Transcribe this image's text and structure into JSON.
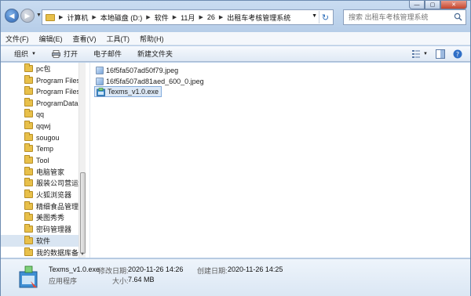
{
  "address": {
    "crumbs": [
      "计算机",
      "本地磁盘 (D:)",
      "软件",
      "11月",
      "26",
      "出租车考核管理系统"
    ]
  },
  "search": {
    "placeholder": "搜索 出租车考核管理系统"
  },
  "window_controls": {
    "minimize": "—",
    "maximize": "▢",
    "close": "✕"
  },
  "menu": {
    "items": [
      "文件(F)",
      "编辑(E)",
      "查看(V)",
      "工具(T)",
      "帮助(H)"
    ]
  },
  "toolbar": {
    "organize": "组织",
    "print": "打开",
    "email": "电子邮件",
    "new_folder": "新建文件夹"
  },
  "nav_tree": {
    "items": [
      {
        "label": "pc包"
      },
      {
        "label": "Program Files"
      },
      {
        "label": "Program Files"
      },
      {
        "label": "ProgramData"
      },
      {
        "label": "qq"
      },
      {
        "label": "qqwj"
      },
      {
        "label": "sougou"
      },
      {
        "label": "Temp"
      },
      {
        "label": "Tool"
      },
      {
        "label": "电脑管家"
      },
      {
        "label": "服装公司营运系统"
      },
      {
        "label": "火狐浏览器"
      },
      {
        "label": "精细食品管理V"
      },
      {
        "label": "美图秀秀"
      },
      {
        "label": "密码管理器"
      },
      {
        "label": "软件",
        "selected": true
      },
      {
        "label": "我的数据库备份"
      }
    ]
  },
  "files": [
    {
      "name": "16f5fa507ad50f79.jpeg",
      "type": "image"
    },
    {
      "name": "16f5fa507ad81aed_600_0.jpeg",
      "type": "image"
    },
    {
      "name": "Texms_v1.0.exe",
      "type": "exe",
      "selected": true
    }
  ],
  "details": {
    "name": "Texms_v1.0.exe",
    "type": "应用程序",
    "modified_label": "修改日期:",
    "modified_value": "2020-11-26 14:26",
    "size_label": "大小:",
    "size_value": "7.64 MB",
    "created_label": "创建日期:",
    "created_value": "2020-11-26 14:25"
  }
}
